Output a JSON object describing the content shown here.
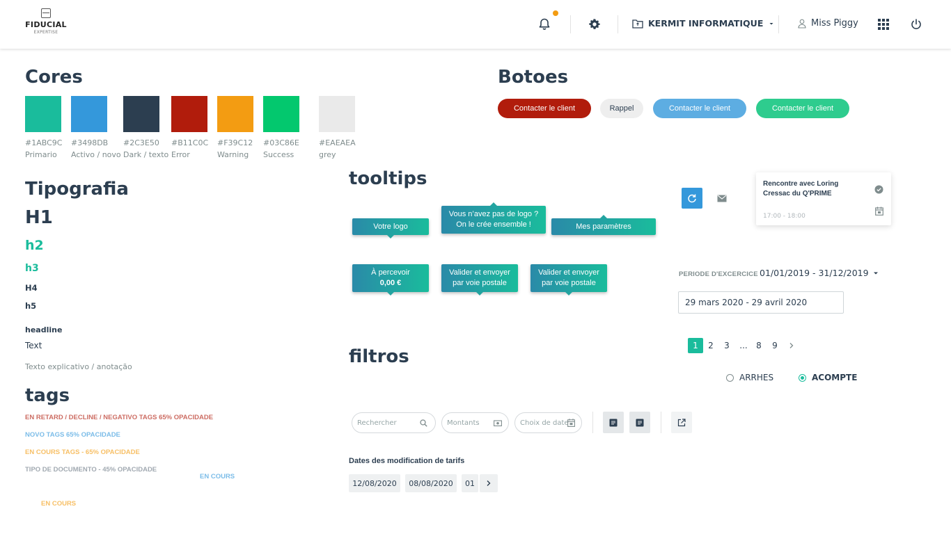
{
  "header": {
    "logo_name": "FIDUCIAL",
    "logo_sub": "EXPERTISE",
    "company": "KERMIT INFORMATIQUE",
    "user": "Miss Piggy"
  },
  "colors_section": {
    "title": "Cores",
    "swatches": [
      {
        "hex": "#1ABC9C",
        "name": "Primario"
      },
      {
        "hex": "#3498DB",
        "name": "Activo / novo"
      },
      {
        "hex": "#2C3E50",
        "name": "Dark / texto"
      },
      {
        "hex": "#B11C0C",
        "name": "Error"
      },
      {
        "hex": "#F39C12",
        "name": "Warning"
      },
      {
        "hex": "#03C86E",
        "name": "Success"
      },
      {
        "hex": "#EAEAEA",
        "name": "grey"
      }
    ]
  },
  "buttons_section": {
    "title": "Botoes",
    "buttons": [
      "Contacter le client",
      "Rappel",
      "Contacter le client",
      "Contacter le client"
    ]
  },
  "typography": {
    "title": "Tipografia",
    "h1": "H1",
    "h2": "h2",
    "h3": "h3",
    "h4": "H4",
    "h5": "h5",
    "headline": "headline",
    "text": "Text",
    "note": "Texto explicativo / anotação"
  },
  "tags": {
    "title": "tags",
    "items": [
      "EN RETARD / DECLINE / NEGATIVO TAGS  65% OPACIDADE",
      "NOVO TAGS  65% OPACIDADE",
      "EN COURS TAGS  - 65% OPACIDADE",
      "TIPO DE DOCUMENTO  - 45% OPACIDADE",
      "EN COURS",
      "EN COURS"
    ]
  },
  "tooltips": {
    "title": "tooltips",
    "votre_logo": "Votre logo",
    "pas_logo_1": "Vous n’avez pas de logo ?",
    "pas_logo_2": "On le crée ensemble !",
    "mes_parametres": "Mes paramètres",
    "a_percevoir_1": "À percevoir",
    "a_percevoir_2": "0,00 €",
    "valider_1a": "Valider et envoyer",
    "valider_1b": "par voie postale",
    "valider_2a": "Valider et envoyer",
    "valider_2b": "par voie postale"
  },
  "event": {
    "title_1": "Rencontre avec Loring",
    "title_2": "Cressac du Q'PRIME",
    "time": "17:00 - 18:00"
  },
  "periode": {
    "label": "PERIODE D'EXCERCICE",
    "value": "01/01/2019 - 31/12/2019",
    "date_range": "29 mars 2020 - 29 avril 2020"
  },
  "pagination": {
    "pages": [
      "1",
      "2",
      "3",
      "...",
      "8",
      "9"
    ],
    "active": "1"
  },
  "radios": {
    "option_1": "ARRHES",
    "option_2": "ACOMPTE",
    "selected": "ACOMPTE"
  },
  "filters": {
    "title": "filtros",
    "search_placeholder": "Rechercher",
    "amounts_placeholder": "Montants",
    "date_placeholder": "Choix de date",
    "dates_label": "Dates des modification de tarifs",
    "dates": [
      "12/08/2020",
      "08/08/2020",
      "01"
    ]
  }
}
